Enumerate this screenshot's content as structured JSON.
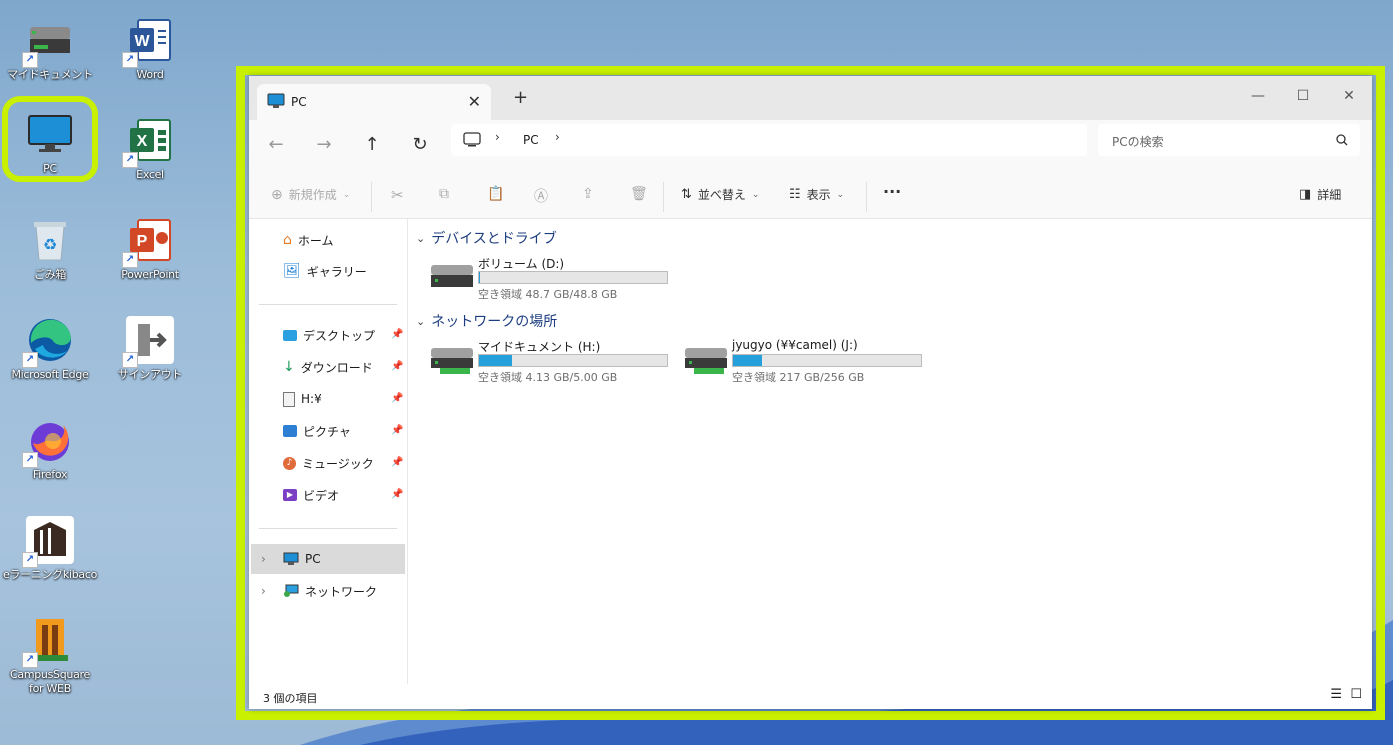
{
  "desktop": {
    "icons": [
      {
        "label": "マイドキュメント"
      },
      {
        "label": "Word"
      },
      {
        "label": "PC"
      },
      {
        "label": "Excel"
      },
      {
        "label": "ごみ箱"
      },
      {
        "label": "PowerPoint"
      },
      {
        "label": "Microsoft Edge"
      },
      {
        "label": "サインアウト"
      },
      {
        "label": "Firefox"
      },
      {
        "label": "eラーニングkibaco"
      },
      {
        "label": "CampusSquare for WEB"
      }
    ]
  },
  "window": {
    "tab_title": "PC",
    "breadcrumb": "PC",
    "search_placeholder": "PCの検索",
    "commands": {
      "new": "新規作成",
      "sort": "並べ替え",
      "view": "表示",
      "details": "詳細"
    },
    "nav": {
      "top": [
        {
          "label": "ホーム"
        },
        {
          "label": "ギャラリー"
        }
      ],
      "pinned": [
        {
          "label": "デスクトップ"
        },
        {
          "label": "ダウンロード"
        },
        {
          "label": "H:¥"
        },
        {
          "label": "ピクチャ"
        },
        {
          "label": "ミュージック"
        },
        {
          "label": "ビデオ"
        }
      ],
      "tree": [
        {
          "label": "PC"
        },
        {
          "label": "ネットワーク"
        }
      ]
    },
    "groups": {
      "devices": "デバイスとドライブ",
      "network": "ネットワークの場所"
    },
    "drives": [
      {
        "name": "ボリューム (D:)",
        "free": "空き領域 48.7 GB/48.8 GB",
        "used": 0.002
      },
      {
        "name": "マイドキュメント (H:)",
        "free": "空き領域 4.13 GB/5.00 GB",
        "used": 0.174
      },
      {
        "name": "jyugyo (¥¥camel) (J:)",
        "free": "空き領域 217 GB/256 GB",
        "used": 0.152
      }
    ],
    "status": "3 個の項目",
    "colors": {
      "highlight": "#c8f000",
      "drive_fill": "#26a0da",
      "group_header": "#1c3d80"
    }
  }
}
